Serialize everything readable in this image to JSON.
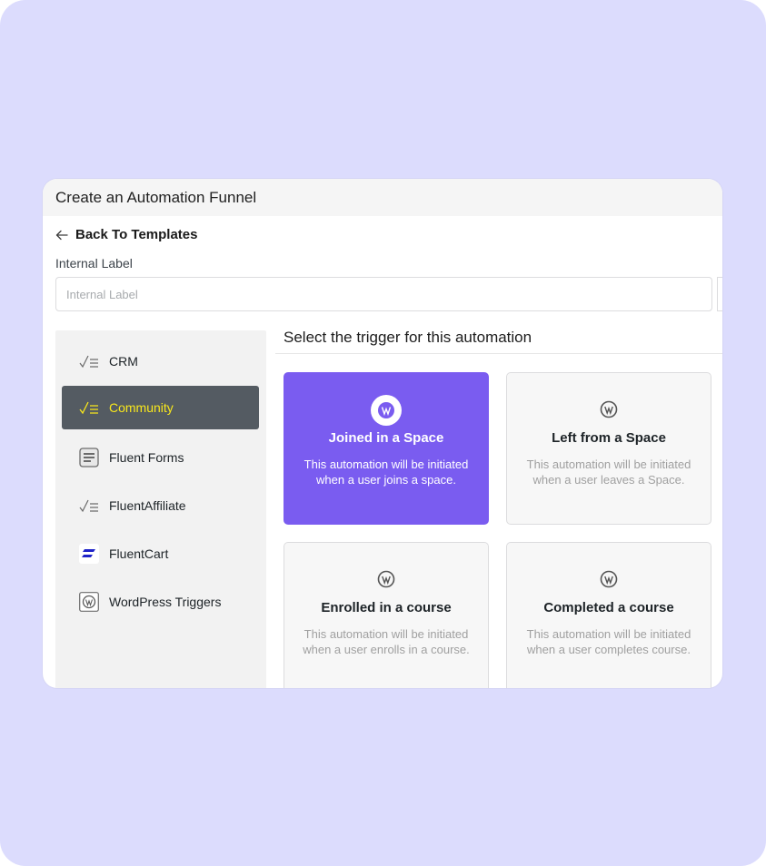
{
  "modal": {
    "title": "Create an Automation Funnel",
    "back_label": "Back To Templates",
    "field_label": "Internal Label",
    "field_placeholder": "Internal Label",
    "field_value": ""
  },
  "sidebar": {
    "items": [
      {
        "label": "CRM",
        "icon": "funnel-check-icon",
        "active": false
      },
      {
        "label": "Community",
        "icon": "funnel-check-icon",
        "active": true
      },
      {
        "label": "Fluent Forms",
        "icon": "fluent-forms-icon",
        "active": false
      },
      {
        "label": "FluentAffiliate",
        "icon": "funnel-check-icon",
        "active": false
      },
      {
        "label": "FluentCart",
        "icon": "fluentcart-icon",
        "active": false
      },
      {
        "label": "WordPress Triggers",
        "icon": "wordpress-icon",
        "active": false
      }
    ]
  },
  "main": {
    "heading": "Select the trigger for this automation",
    "triggers": [
      {
        "title": "Joined in a Space",
        "description": "This automation will be initiated when a user joins a space.",
        "icon": "wordpress-icon",
        "selected": true
      },
      {
        "title": "Left from a Space",
        "description": "This automation will be initiated when a user leaves a Space.",
        "icon": "wordpress-icon",
        "selected": false
      },
      {
        "title": "Enrolled in a course",
        "description": "This automation will be initiated when a user enrolls in a course.",
        "icon": "wordpress-icon",
        "selected": false
      },
      {
        "title": "Completed a course",
        "description": "This automation will be initiated when a user completes course.",
        "icon": "wordpress-icon",
        "selected": false
      }
    ]
  },
  "colors": {
    "backdrop": "#dcdcfd",
    "accent_selected": "#7a5cf0",
    "sidebar_active_bg": "#545b62",
    "sidebar_active_text": "#f8e71c",
    "fluentcart_brand": "#1e22c8"
  }
}
